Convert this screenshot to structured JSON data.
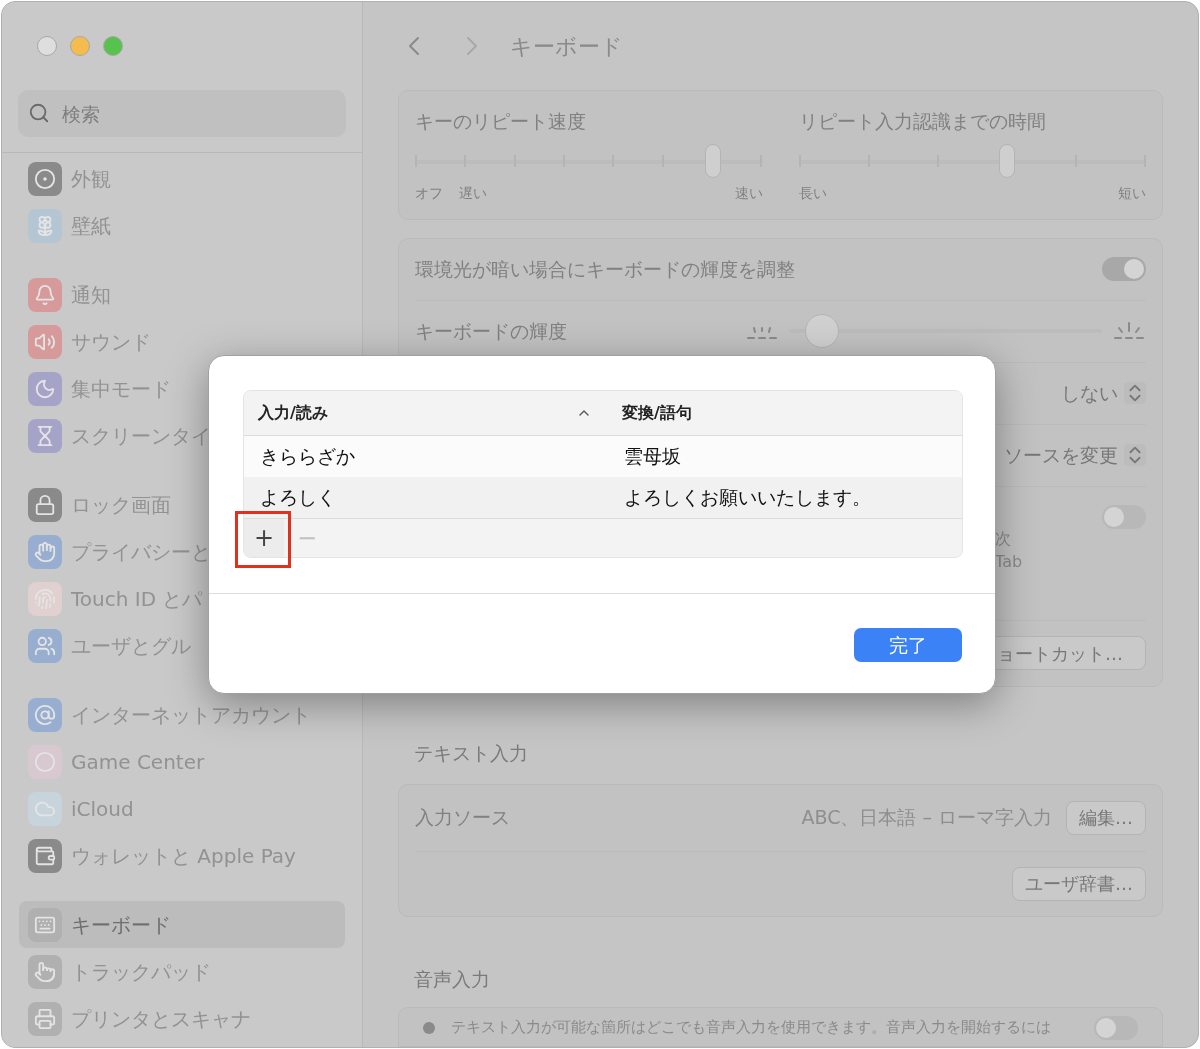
{
  "window": {
    "traffic_lights": [
      {
        "color": "#dedede"
      },
      {
        "color": "#f4bc4c"
      },
      {
        "color": "#58c24e"
      }
    ]
  },
  "search": {
    "placeholder": "検索"
  },
  "sidebar": {
    "groups": [
      {
        "items": [
          {
            "label": "外観",
            "selected": false
          },
          {
            "label": "壁紙",
            "selected": false
          }
        ]
      },
      {
        "items": [
          {
            "label": "通知",
            "selected": false
          },
          {
            "label": "サウンド",
            "selected": false
          },
          {
            "label": "集中モード",
            "selected": false
          },
          {
            "label": "スクリーンタイ",
            "selected": false
          }
        ]
      },
      {
        "items": [
          {
            "label": "ロック画面",
            "selected": false
          },
          {
            "label": "プライバシーと",
            "selected": false
          },
          {
            "label": "Touch ID とパ",
            "selected": false
          },
          {
            "label": "ユーザとグル",
            "selected": false
          }
        ]
      },
      {
        "items": [
          {
            "label": "インターネットアカウント",
            "selected": false
          },
          {
            "label": "Game Center",
            "selected": false
          },
          {
            "label": "iCloud",
            "selected": false
          },
          {
            "label": "ウォレットと Apple Pay",
            "selected": false
          }
        ]
      },
      {
        "items": [
          {
            "label": "キーボード",
            "selected": true
          },
          {
            "label": "トラックパッド",
            "selected": false
          },
          {
            "label": "プリンタとスキャナ",
            "selected": false
          }
        ]
      }
    ]
  },
  "toolbar": {
    "title": "キーボード"
  },
  "repeat": {
    "sliders": [
      {
        "label": "キーのリピート速度",
        "level": 0.857,
        "left_labels": [
          "オフ",
          "遅い"
        ],
        "right_label": "速い"
      },
      {
        "label": "リピート入力認識までの時間",
        "level": 0.6,
        "left_labels": [
          "長い"
        ],
        "right_label": "短い"
      }
    ]
  },
  "brightness": {
    "ambient": {
      "label": "環境光が暗い場合にキーボードの輝度を調整",
      "on": true
    },
    "keyboard": {
      "label": "キーボードの輝度",
      "level": 0.05
    }
  },
  "partial_rows": [
    {
      "kind": "select",
      "value": "しない"
    },
    {
      "kind": "select",
      "value": "ソースを変更"
    },
    {
      "kind": "toggle",
      "on": false,
      "lines": [
        "次",
        "Tab"
      ]
    },
    {
      "kind": "button",
      "label": "ョートカット…"
    }
  ],
  "text_input": {
    "heading": "テキスト入力",
    "source_label": "入力ソース",
    "source_value": "ABC、日本語 – ローマ字入力",
    "edit_button": "編集…",
    "dictionary_button": "ユーザ辞書…"
  },
  "voice_input": {
    "heading": "音声入力",
    "description": "テキスト入力が可能な箇所はどこでも音声入力を使用できます。音声入力を開始するには",
    "on": false
  },
  "dialog": {
    "columns": [
      {
        "label": "入力/読み",
        "sorted": true
      },
      {
        "label": "変換/語句",
        "sorted": false
      }
    ],
    "rows": [
      {
        "reading": "きららざか",
        "phrase": "雲母坂"
      },
      {
        "reading": "よろしく",
        "phrase": "よろしくお願いいたします。"
      }
    ],
    "add": "+",
    "remove": "−",
    "remove_disabled": true,
    "add_highlighted": true,
    "done": "完了"
  }
}
